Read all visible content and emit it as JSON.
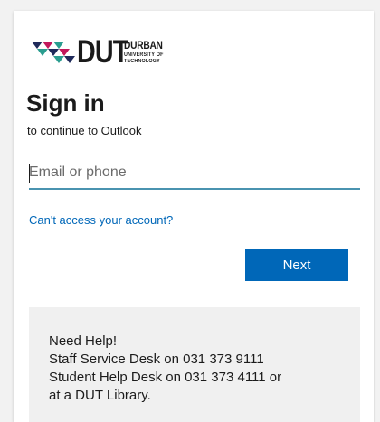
{
  "logo": {
    "mark_icon": "dut-triangles-mark",
    "wordmark": "DUT",
    "line1": "DURBAN",
    "line2": "UNIVERSITY OF",
    "line3": "TECHNOLOGY"
  },
  "signin": {
    "title": "Sign in",
    "subtitle": "to continue to Outlook"
  },
  "email": {
    "value": "",
    "placeholder": "Email or phone"
  },
  "links": {
    "cant_access": "Can't access your account?"
  },
  "buttons": {
    "next": "Next"
  },
  "help": {
    "line1": "Need Help!",
    "line2": "Staff Service Desk on 031 373 9111",
    "line3": "Student Help Desk on 031 373 4111 or",
    "line4": "at a DUT Library."
  },
  "colors": {
    "accent": "#0067b8",
    "input_underline": "#4a93b0",
    "logo_teal": "#2a9d8f",
    "logo_pink": "#c2185b",
    "logo_navy": "#1f2a5a"
  }
}
